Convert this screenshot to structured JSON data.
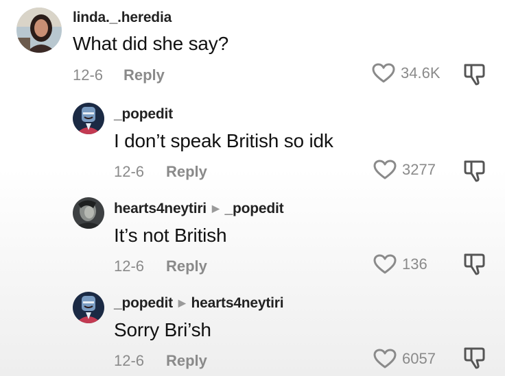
{
  "comments": [
    {
      "username": "linda._.heredia",
      "text": "What did she say?",
      "date": "12-6",
      "reply_label": "Reply",
      "likes": "34.6K"
    },
    {
      "username": "_popedit",
      "text": "I don’t speak British so idk",
      "date": "12-6",
      "reply_label": "Reply",
      "likes": "3277"
    },
    {
      "username": "hearts4neytiri",
      "reply_to": "_popedit",
      "text": "It’s not British",
      "date": "12-6",
      "reply_label": "Reply",
      "likes": "136"
    },
    {
      "username": "_popedit",
      "reply_to": "hearts4neytiri",
      "text": "Sorry Bri’sh",
      "date": "12-6",
      "reply_label": "Reply",
      "likes": "6057"
    }
  ],
  "icons": {
    "like": "heart-outline-icon",
    "dislike": "thumbs-down-icon",
    "reply_arrow": "triangle-right-icon"
  },
  "colors": {
    "text": "#111111",
    "muted": "#8a8a8a"
  }
}
